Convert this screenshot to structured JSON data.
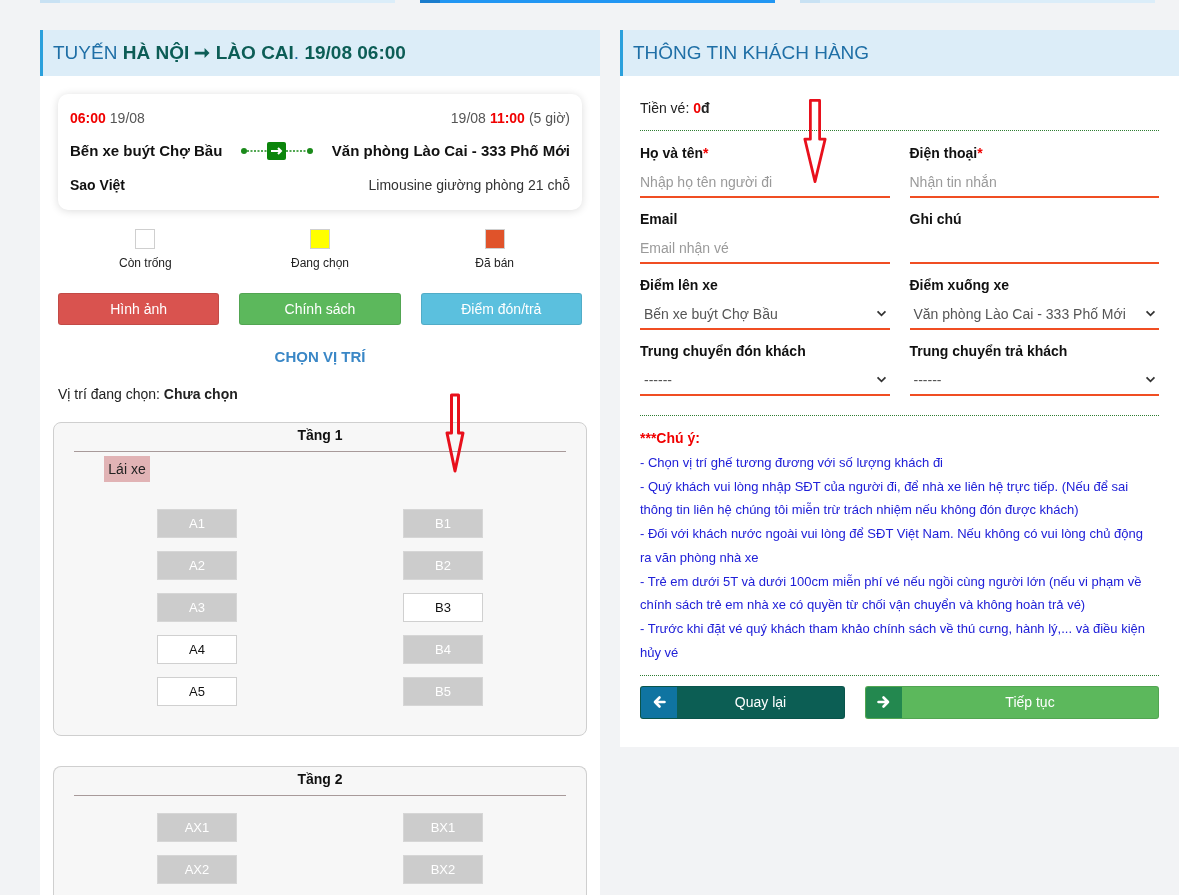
{
  "steps": [
    {
      "selected": false
    },
    {
      "selected": true
    },
    {
      "selected": false
    }
  ],
  "trip_panel": {
    "title": "TUYẾN **HÀ NỘI ➞ LÀO CAI**. **19/08 06:00**",
    "trip": {
      "depart_time": "06:00",
      "depart_date": "19/08",
      "arrive_date": "19/08",
      "arrive_time": "11:00",
      "duration": "(5 giờ)",
      "origin": "Bến xe buýt Chợ Bầu",
      "destination": "Văn phòng Lào Cai - 333 Phố Mới",
      "operator": "Sao Việt",
      "vehicle": "Limousine giường phòng 21 chỗ"
    },
    "legend": [
      {
        "label": "Còn trống",
        "color": "#ffffff"
      },
      {
        "label": "Đang chọn",
        "color": "#ffff00"
      },
      {
        "label": "Đã bán",
        "color": "#e0532a"
      }
    ],
    "buttons": [
      {
        "label": "Hình ảnh",
        "color": "#d9534f"
      },
      {
        "label": "Chính sách",
        "color": "#5cb85c"
      },
      {
        "label": "Điểm đón/trả",
        "color": "#5bc0de"
      }
    ],
    "seat_heading": "CHỌN VỊ TRÍ",
    "selected_seat": "Vị trí đang chọn: **Chưa chọn**",
    "decks": [
      {
        "title": "Tầng 1",
        "driver": "Lái xe",
        "pointer_arrow": true,
        "rows": [
          [
            {
              "label": "A1",
              "available": false
            },
            {
              "label": "B1",
              "available": false
            }
          ],
          [
            {
              "label": "A2",
              "available": false
            },
            {
              "label": "B2",
              "available": false
            }
          ],
          [
            {
              "label": "A3",
              "available": false
            },
            {
              "label": "B3",
              "available": true
            }
          ],
          [
            {
              "label": "A4",
              "available": true
            },
            {
              "label": "B4",
              "available": false
            }
          ],
          [
            {
              "label": "A5",
              "available": true
            },
            {
              "label": "B5",
              "available": false
            }
          ]
        ]
      },
      {
        "title": "Tầng 2",
        "rows": [
          [
            {
              "label": "AX1",
              "available": false
            },
            {
              "label": "BX1",
              "available": false
            }
          ],
          [
            {
              "label": "AX2",
              "available": false
            },
            {
              "label": "BX2",
              "available": false
            }
          ]
        ]
      }
    ]
  },
  "customer_panel": {
    "title": "THÔNG TIN KHÁCH HÀNG",
    "fare": {
      "label": "Tiền vé:",
      "amount": "0",
      "currency": "đ"
    },
    "fields": [
      {
        "kind": "input",
        "label": "Họ và tên",
        "required_mark": "*",
        "placeholder": "Nhập họ tên người đi",
        "pointer_arrow": true
      },
      {
        "kind": "input",
        "label": "Điện thoại",
        "required_mark": "*",
        "placeholder": "Nhận tin nhắn"
      },
      {
        "kind": "input",
        "label": "Email",
        "placeholder": "Email nhận vé"
      },
      {
        "kind": "input",
        "label": "Ghi chú"
      },
      {
        "kind": "select",
        "label": "Điểm lên xe",
        "value": "Bến xe buýt Chợ Bầu"
      },
      {
        "kind": "select",
        "label": "Điểm xuống xe",
        "value": "Văn phòng Lào Cai - 333 Phố Mới"
      },
      {
        "kind": "select",
        "label": "Trung chuyển đón khách",
        "value": "------"
      },
      {
        "kind": "select",
        "label": "Trung chuyển trả khách",
        "value": "------"
      }
    ],
    "notice": {
      "heading": "***Chú ý:",
      "items": [
        "- Chọn vị trí ghế tương đương với số lượng khách đi",
        "- Quý khách vui lòng nhập SĐT của người đi, để nhà xe liên hệ trực tiếp. (Nếu để sai thông tin liên hệ chúng tôi miễn trừ trách nhiệm nếu không đón được khách)",
        "- Đối với khách nước ngoài vui lòng để SĐT Việt Nam. Nếu không có vui lòng chủ động ra văn phòng nhà xe",
        "- Trẻ em dưới 5T và dưới 100cm miễn phí vé nếu ngồi cùng người lớn (nếu vi phạm về chính sách trẻ em nhà xe có quyền từ chối vận chuyển và không hoàn trả vé)",
        "- Trước khi đặt vé quý khách tham khảo chính sách về thú cưng, hành lý,... và điều kiện hủy vé"
      ]
    },
    "buttons": [
      {
        "kind": "back",
        "label": "Quay lại"
      },
      {
        "kind": "next",
        "label": "Tiếp tục"
      }
    ]
  }
}
